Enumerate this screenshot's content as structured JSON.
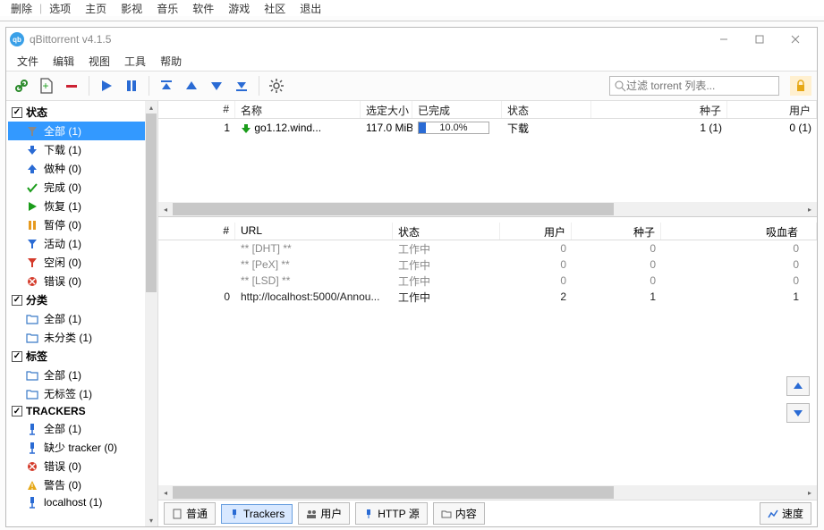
{
  "top_menu": [
    "删除",
    "选项",
    "主页",
    "影视",
    "音乐",
    "软件",
    "游戏",
    "社区",
    "退出"
  ],
  "window": {
    "title": "qBittorrent v4.1.5"
  },
  "menubar": [
    "文件",
    "编辑",
    "视图",
    "工具",
    "帮助"
  ],
  "toolbar": {
    "search_placeholder": "过滤 torrent 列表..."
  },
  "sidebar": {
    "status_head": "状态",
    "status": [
      {
        "label": "全部 (1)",
        "icon": "filter",
        "sel": true,
        "color": "#888"
      },
      {
        "label": "下载 (1)",
        "icon": "down",
        "color": "#2a6bd4"
      },
      {
        "label": "做种 (0)",
        "icon": "up",
        "color": "#2a6bd4"
      },
      {
        "label": "完成 (0)",
        "icon": "check",
        "color": "#1a9c1a"
      },
      {
        "label": "恢复 (1)",
        "icon": "play",
        "color": "#1a9c1a"
      },
      {
        "label": "暂停 (0)",
        "icon": "pause",
        "color": "#e69a1f"
      },
      {
        "label": "活动 (1)",
        "icon": "filter",
        "color": "#2a6bd4"
      },
      {
        "label": "空闲 (0)",
        "icon": "filter",
        "color": "#d43a2a"
      },
      {
        "label": "错误 (0)",
        "icon": "error",
        "color": "#d43a2a"
      }
    ],
    "category_head": "分类",
    "category": [
      {
        "label": "全部 (1)",
        "icon": "folder"
      },
      {
        "label": "未分类 (1)",
        "icon": "folder"
      }
    ],
    "tags_head": "标签",
    "tags": [
      {
        "label": "全部 (1)",
        "icon": "folder"
      },
      {
        "label": "无标签 (1)",
        "icon": "folder"
      }
    ],
    "trackers_head": "TRACKERS",
    "trackers": [
      {
        "label": "全部 (1)",
        "icon": "tracker"
      },
      {
        "label": "缺少 tracker (0)",
        "icon": "tracker"
      },
      {
        "label": "错误 (0)",
        "icon": "error"
      },
      {
        "label": "警告 (0)",
        "icon": "warn"
      },
      {
        "label": "localhost (1)",
        "icon": "tracker"
      }
    ]
  },
  "torrent_table": {
    "headers": {
      "num": "#",
      "name": "名称",
      "size": "选定大小",
      "done": "已完成",
      "status": "状态",
      "seeds": "种子",
      "peers": "用户"
    },
    "rows": [
      {
        "num": "1",
        "name": "go1.12.wind...",
        "size": "117.0 MiB",
        "done_pct": "10.0%",
        "done_width": "10%",
        "status": "下载",
        "seeds": "1 (1)",
        "peers": "0 (1)"
      }
    ]
  },
  "detail_table": {
    "headers": {
      "num": "#",
      "url": "URL",
      "status": "状态",
      "peers": "用户",
      "seeds": "种子",
      "leech": "吸血者"
    },
    "rows": [
      {
        "num": "",
        "url": "** [DHT] **",
        "status": "工作中",
        "peers": "0",
        "seeds": "0",
        "leech": "0",
        "dim": true
      },
      {
        "num": "",
        "url": "** [PeX] **",
        "status": "工作中",
        "peers": "0",
        "seeds": "0",
        "leech": "0",
        "dim": true
      },
      {
        "num": "",
        "url": "** [LSD] **",
        "status": "工作中",
        "peers": "0",
        "seeds": "0",
        "leech": "0",
        "dim": true
      },
      {
        "num": "0",
        "url": "http://localhost:5000/Annou...",
        "status": "工作中",
        "peers": "2",
        "seeds": "1",
        "leech": "1",
        "dim": false
      }
    ]
  },
  "bottom_tabs": {
    "general": "普通",
    "trackers": "Trackers",
    "peers": "用户",
    "http": "HTTP 源",
    "content": "内容",
    "speed": "速度"
  }
}
